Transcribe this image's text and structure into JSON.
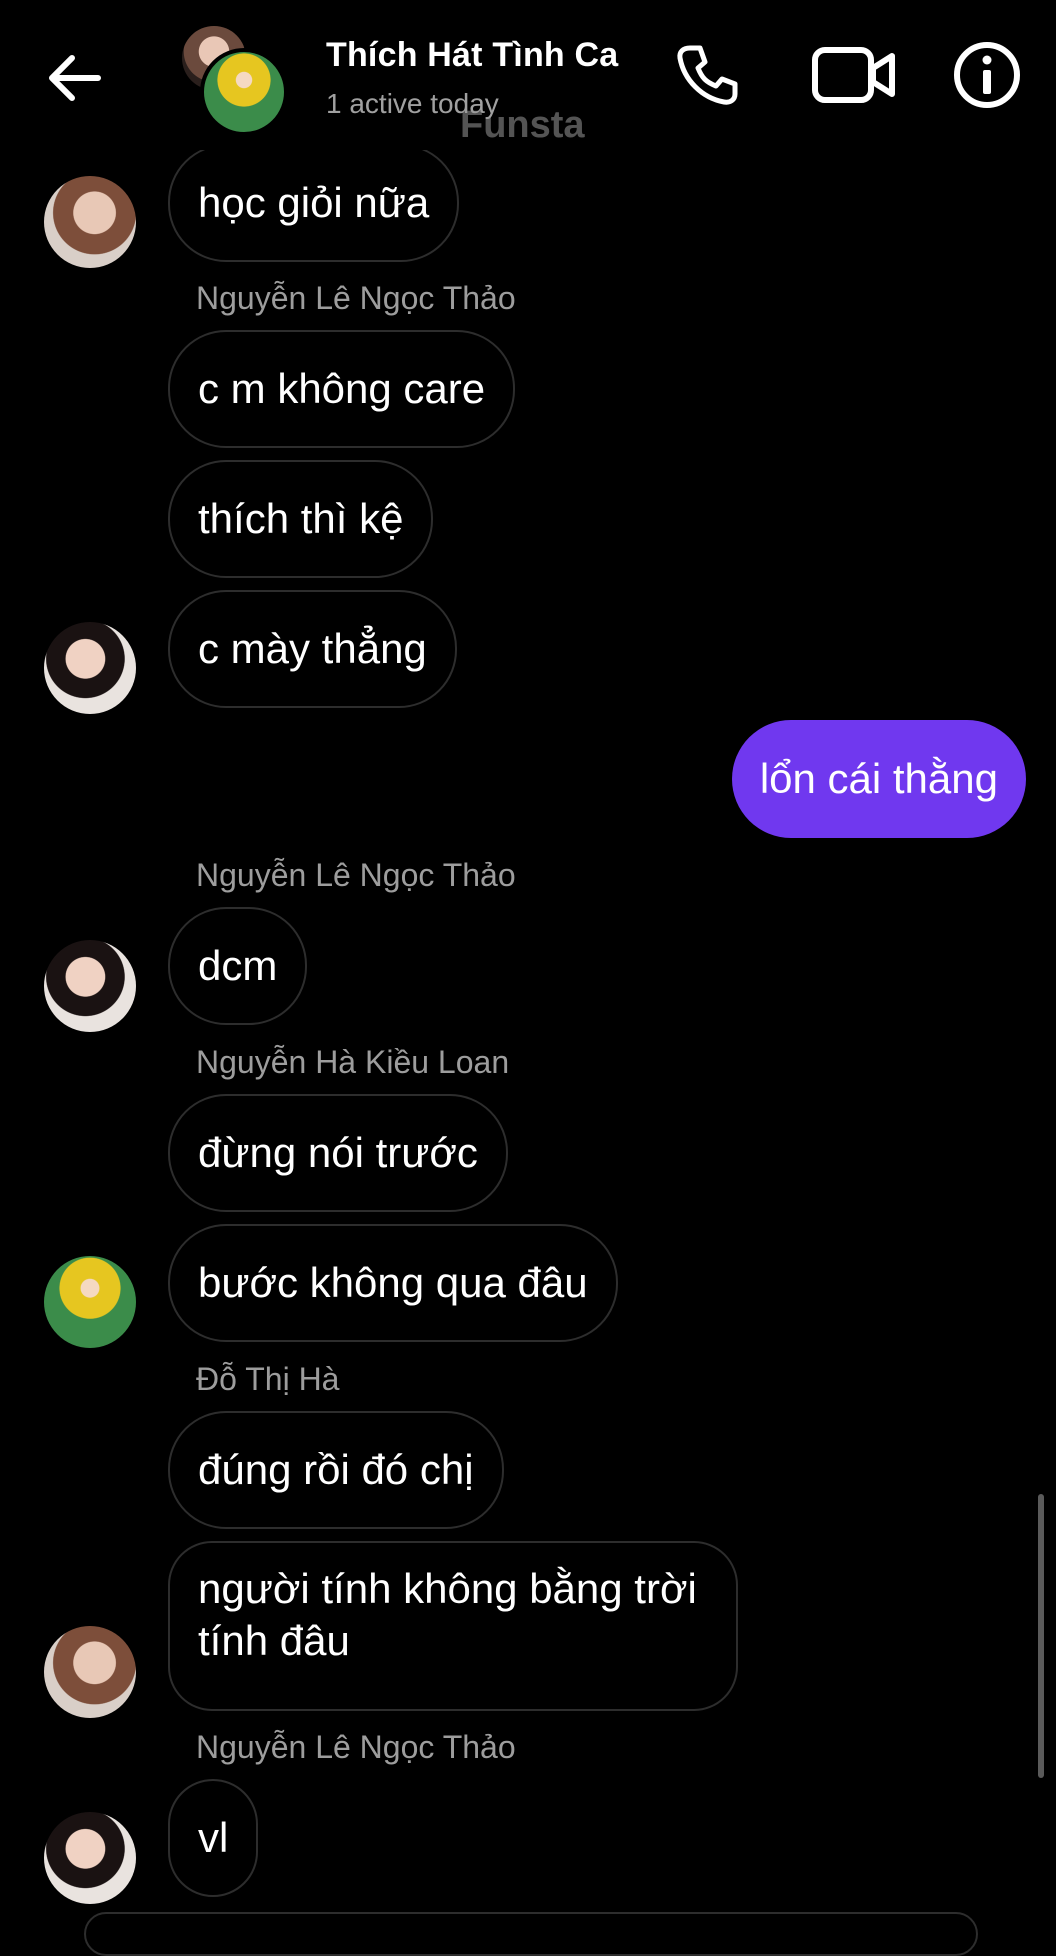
{
  "header": {
    "title": "Thích Hát Tình Ca",
    "status": "1 active today",
    "watermark": "Funsta"
  },
  "icons": {
    "back": "arrow-left-icon",
    "call": "phone-icon",
    "video": "video-camera-icon",
    "info": "info-icon"
  },
  "colors": {
    "accent": "#7038EF",
    "background": "#000000",
    "bubble_border": "#2D2D2D",
    "sender_name": "#9D9D9D"
  },
  "messages": [
    {
      "text": "học giỏi nữa"
    },
    {
      "sender": "Nguyễn Lê Ngọc Thảo"
    },
    {
      "text": "c m không care"
    },
    {
      "text": "thích thì kệ"
    },
    {
      "text": "c mày thẳng"
    },
    {
      "text": "lổn cái thằng",
      "mine": true
    },
    {
      "sender": "Nguyễn Lê Ngọc Thảo"
    },
    {
      "text": "dcm"
    },
    {
      "sender": "Nguyễn Hà Kiều Loan"
    },
    {
      "text": "đừng nói trước"
    },
    {
      "text": "bước không qua đâu"
    },
    {
      "sender": "Đỗ Thị Hà"
    },
    {
      "text": "đúng rồi đó chị"
    },
    {
      "text": "người tính không bằng trời tính đâu"
    },
    {
      "sender": "Nguyễn Lê Ngọc Thảo"
    },
    {
      "text": "vl"
    }
  ]
}
